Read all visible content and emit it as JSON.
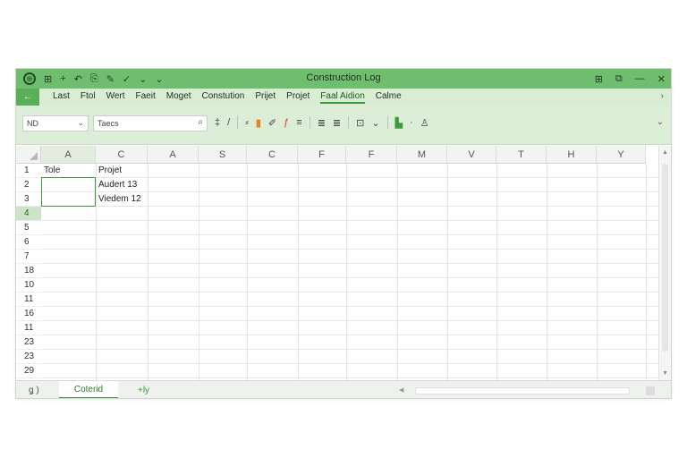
{
  "window": {
    "title": "Construction Log"
  },
  "titlebar": {
    "left_icons": [
      "app-logo",
      "grid-icon",
      "plus-icon",
      "undo-icon",
      "save-icon",
      "brush-icon",
      "check-icon",
      "chevron-down-icon",
      "chevron-down-icon"
    ],
    "right_icons": [
      "restore-icon",
      "layout-icon",
      "minimize-icon",
      "close-icon"
    ]
  },
  "menu": {
    "back_label": "←",
    "items": [
      "Last",
      "Ftol",
      "Wert",
      "Faeit",
      "Moget",
      "Constution",
      "Prijet",
      "Projet",
      "Faal Aidion",
      "Calme"
    ],
    "active_index": 8
  },
  "toolbar": {
    "namebox_value": "ND",
    "font_value": "Taecs"
  },
  "sheet": {
    "columns": [
      "A",
      "C",
      "A",
      "S",
      "C",
      "F",
      "F",
      "M",
      "V",
      "T",
      "H",
      "Y"
    ],
    "selected_column_index": 0,
    "rows": [
      "1",
      "2",
      "3",
      "4",
      "5",
      "6",
      "7",
      "18",
      "10",
      "11",
      "16",
      "11",
      "23",
      "23",
      "29"
    ],
    "selected_row_index": 3,
    "cells": {
      "r1c1": "Tole",
      "r1c2": "Projet",
      "r2c2": "Audert 13",
      "r3c2": "Viedem 12"
    }
  },
  "bottom": {
    "nav_label": "ǥ )",
    "sheet_tab": "Coterid",
    "add_label": "+ly"
  },
  "colors": {
    "accent": "#6fbd6f",
    "ribbon": "#d8edd2",
    "selection": "#3f9a3f"
  }
}
